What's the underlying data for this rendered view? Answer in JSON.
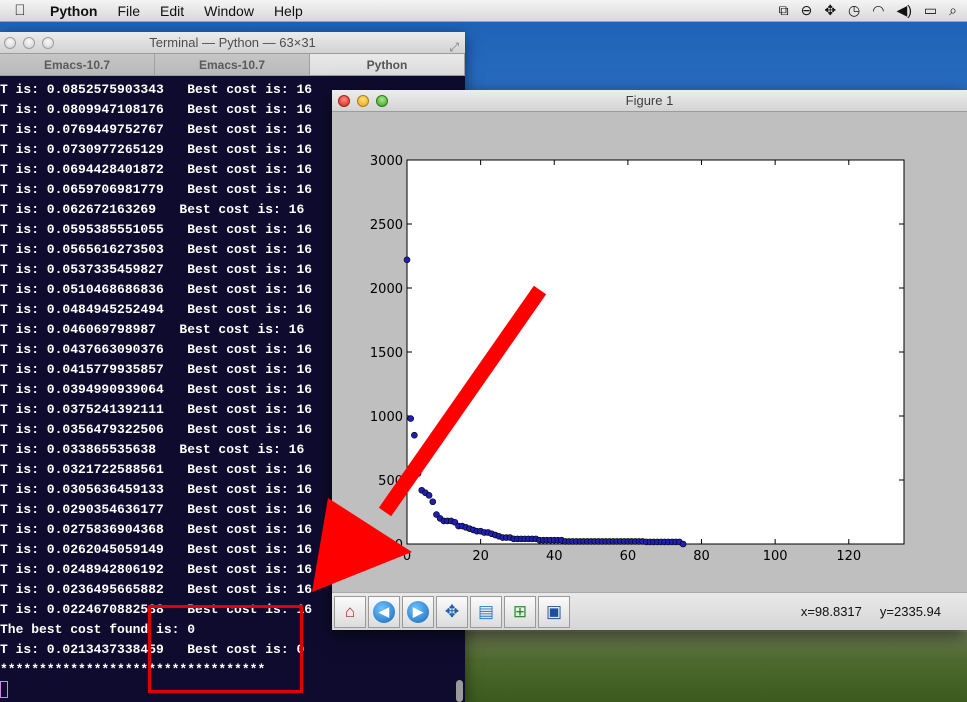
{
  "menubar": {
    "app_name": "Python",
    "items": [
      "File",
      "Edit",
      "Window",
      "Help"
    ]
  },
  "terminal": {
    "title": "Terminal — Python — 63×31",
    "tabs": [
      "Emacs-10.7",
      "Emacs-10.7",
      "Python"
    ],
    "active_tab": 2,
    "lines": [
      "T is: 0.0852575903343   Best cost is: 16",
      "T is: 0.0809947108176   Best cost is: 16",
      "T is: 0.0769449752767   Best cost is: 16",
      "T is: 0.0730977265129   Best cost is: 16",
      "T is: 0.0694428401872   Best cost is: 16",
      "T is: 0.0659706981779   Best cost is: 16",
      "T is: 0.062672163269   Best cost is: 16",
      "T is: 0.0595385551055   Best cost is: 16",
      "T is: 0.0565616273503   Best cost is: 16",
      "T is: 0.0537335459827   Best cost is: 16",
      "T is: 0.0510468686836   Best cost is: 16",
      "T is: 0.0484945252494   Best cost is: 16",
      "T is: 0.046069798987   Best cost is: 16",
      "T is: 0.0437663090376   Best cost is: 16",
      "T is: 0.0415779935857   Best cost is: 16",
      "T is: 0.0394990939064   Best cost is: 16",
      "T is: 0.0375241392111   Best cost is: 16",
      "T is: 0.0356479322506   Best cost is: 16",
      "T is: 0.033865535638   Best cost is: 16",
      "T is: 0.0321722588561   Best cost is: 16",
      "T is: 0.0305636459133   Best cost is: 16",
      "T is: 0.0290354636177   Best cost is: 16",
      "T is: 0.0275836904368   Best cost is: 16",
      "T is: 0.0262045059149   Best cost is: 16",
      "T is: 0.0248942806192   Best cost is: 16",
      "T is: 0.0236495665882   Best cost is: 16",
      "T is: 0.0224670882588   Best cost is: 16",
      "The best cost found is: 0",
      "T is: 0.0213437338459   Best cost is: 0",
      "**********************************"
    ]
  },
  "figure": {
    "title": "Figure 1",
    "coords": {
      "x": "x=98.8317",
      "y": "y=2335.94"
    },
    "tools": [
      "home-icon",
      "back-icon",
      "forward-icon",
      "pan-icon",
      "subplots-icon",
      "zoom-icon",
      "save-icon"
    ]
  },
  "chart_data": {
    "type": "scatter",
    "title": "",
    "xlabel": "",
    "ylabel": "",
    "xlim": [
      0,
      135
    ],
    "ylim": [
      0,
      3000
    ],
    "xticks": [
      0,
      20,
      40,
      60,
      80,
      100,
      120
    ],
    "yticks": [
      0,
      500,
      1000,
      1500,
      2000,
      2500,
      3000
    ],
    "grid": false,
    "marker_color": "#1f1fb4",
    "x": [
      0,
      1,
      2,
      3,
      4,
      5,
      6,
      7,
      8,
      9,
      10,
      11,
      12,
      13,
      14,
      15,
      16,
      17,
      18,
      19,
      20,
      21,
      22,
      23,
      24,
      25,
      26,
      27,
      28,
      29,
      30,
      31,
      32,
      33,
      34,
      35,
      36,
      37,
      38,
      39,
      40,
      41,
      42,
      43,
      44,
      45,
      46,
      47,
      48,
      49,
      50,
      51,
      52,
      53,
      54,
      55,
      56,
      57,
      58,
      59,
      60,
      61,
      62,
      63,
      64,
      65,
      66,
      67,
      68,
      69,
      70,
      71,
      72,
      73,
      74,
      75
    ],
    "y": [
      2220,
      980,
      850,
      550,
      420,
      400,
      380,
      330,
      230,
      200,
      180,
      180,
      180,
      170,
      140,
      140,
      130,
      120,
      110,
      100,
      100,
      90,
      90,
      80,
      70,
      60,
      50,
      50,
      50,
      40,
      40,
      40,
      40,
      40,
      40,
      40,
      30,
      30,
      30,
      30,
      30,
      30,
      30,
      20,
      20,
      20,
      20,
      20,
      20,
      20,
      20,
      20,
      20,
      20,
      20,
      20,
      20,
      20,
      20,
      20,
      20,
      20,
      20,
      20,
      20,
      16,
      16,
      16,
      16,
      16,
      16,
      16,
      16,
      16,
      16,
      0
    ]
  }
}
